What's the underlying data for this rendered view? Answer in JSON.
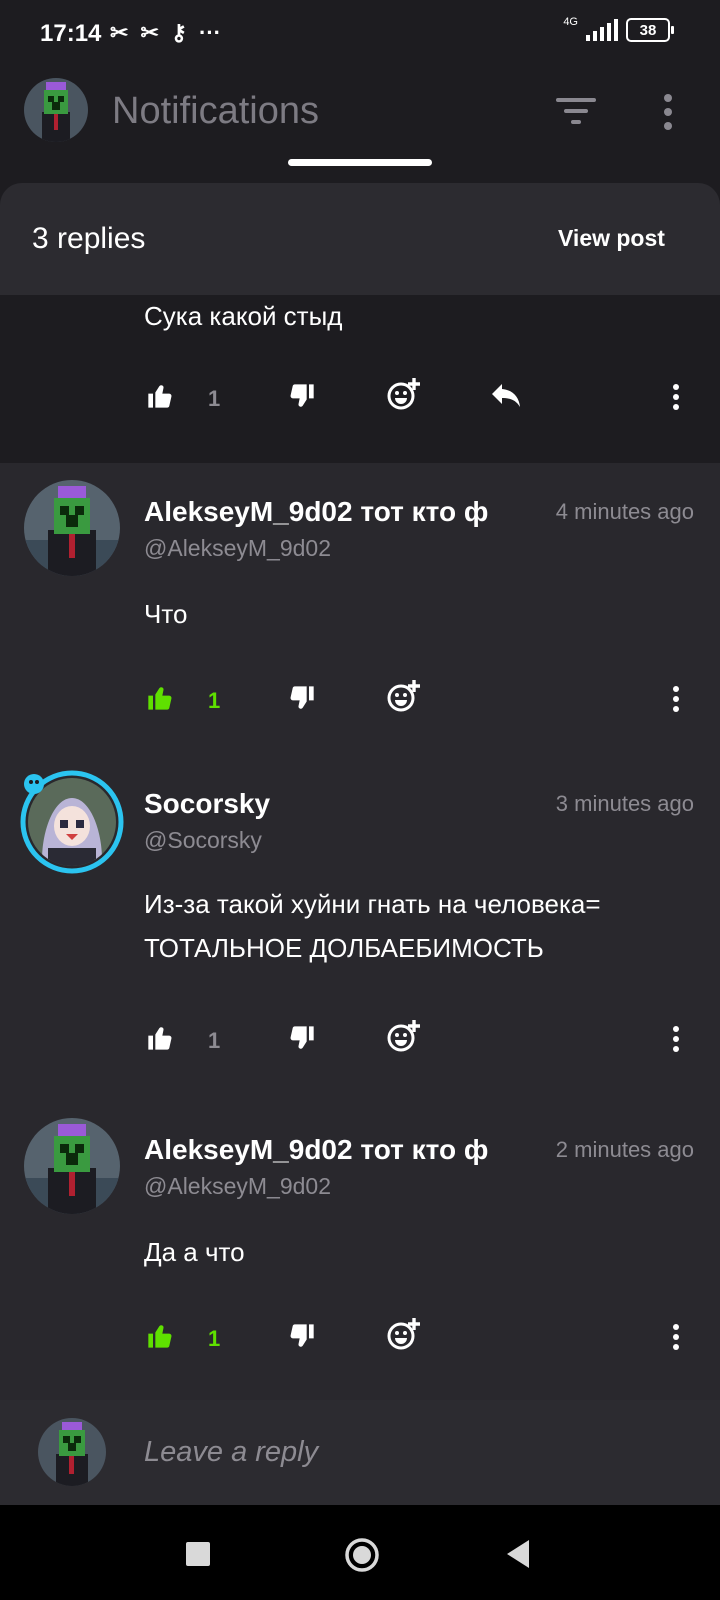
{
  "status_bar": {
    "time": "17:14",
    "icons_left": [
      "capcut-icon",
      "capcut-icon",
      "key-icon",
      "more-dots-icon"
    ],
    "network": "4G",
    "battery": "38"
  },
  "header": {
    "title": "Notifications"
  },
  "sheet": {
    "replies_label": "3 replies",
    "view_post_label": "View post"
  },
  "parent_comment": {
    "text": "Сука какой стыд",
    "likes": "1",
    "liked": false
  },
  "comments": [
    {
      "name": "AlekseyM_9d02 тот кто ф",
      "handle": "@AlekseyM_9d02",
      "time": "4 minutes ago",
      "text": "Что",
      "likes": "1",
      "liked": true
    },
    {
      "name": "Socorsky",
      "handle": "@Socorsky",
      "time": "3 minutes ago",
      "text": "Из-за такой хуйни гнать на человека= ТОТАЛЬНОЕ ДОЛБАЕБИМОСТЬ",
      "likes": "1",
      "liked": false
    },
    {
      "name": "AlekseyM_9d02 тот кто ф",
      "handle": "@AlekseyM_9d02",
      "time": "2 minutes ago",
      "text": "Да а что",
      "likes": "1",
      "liked": true
    }
  ],
  "reply_bar": {
    "placeholder": "Leave a reply"
  },
  "colors": {
    "background": "#1d1c20",
    "card": "#29282d",
    "sheet_header": "#2c2b30",
    "liked_green": "#5fe000",
    "muted_text": "#8d8b92"
  }
}
